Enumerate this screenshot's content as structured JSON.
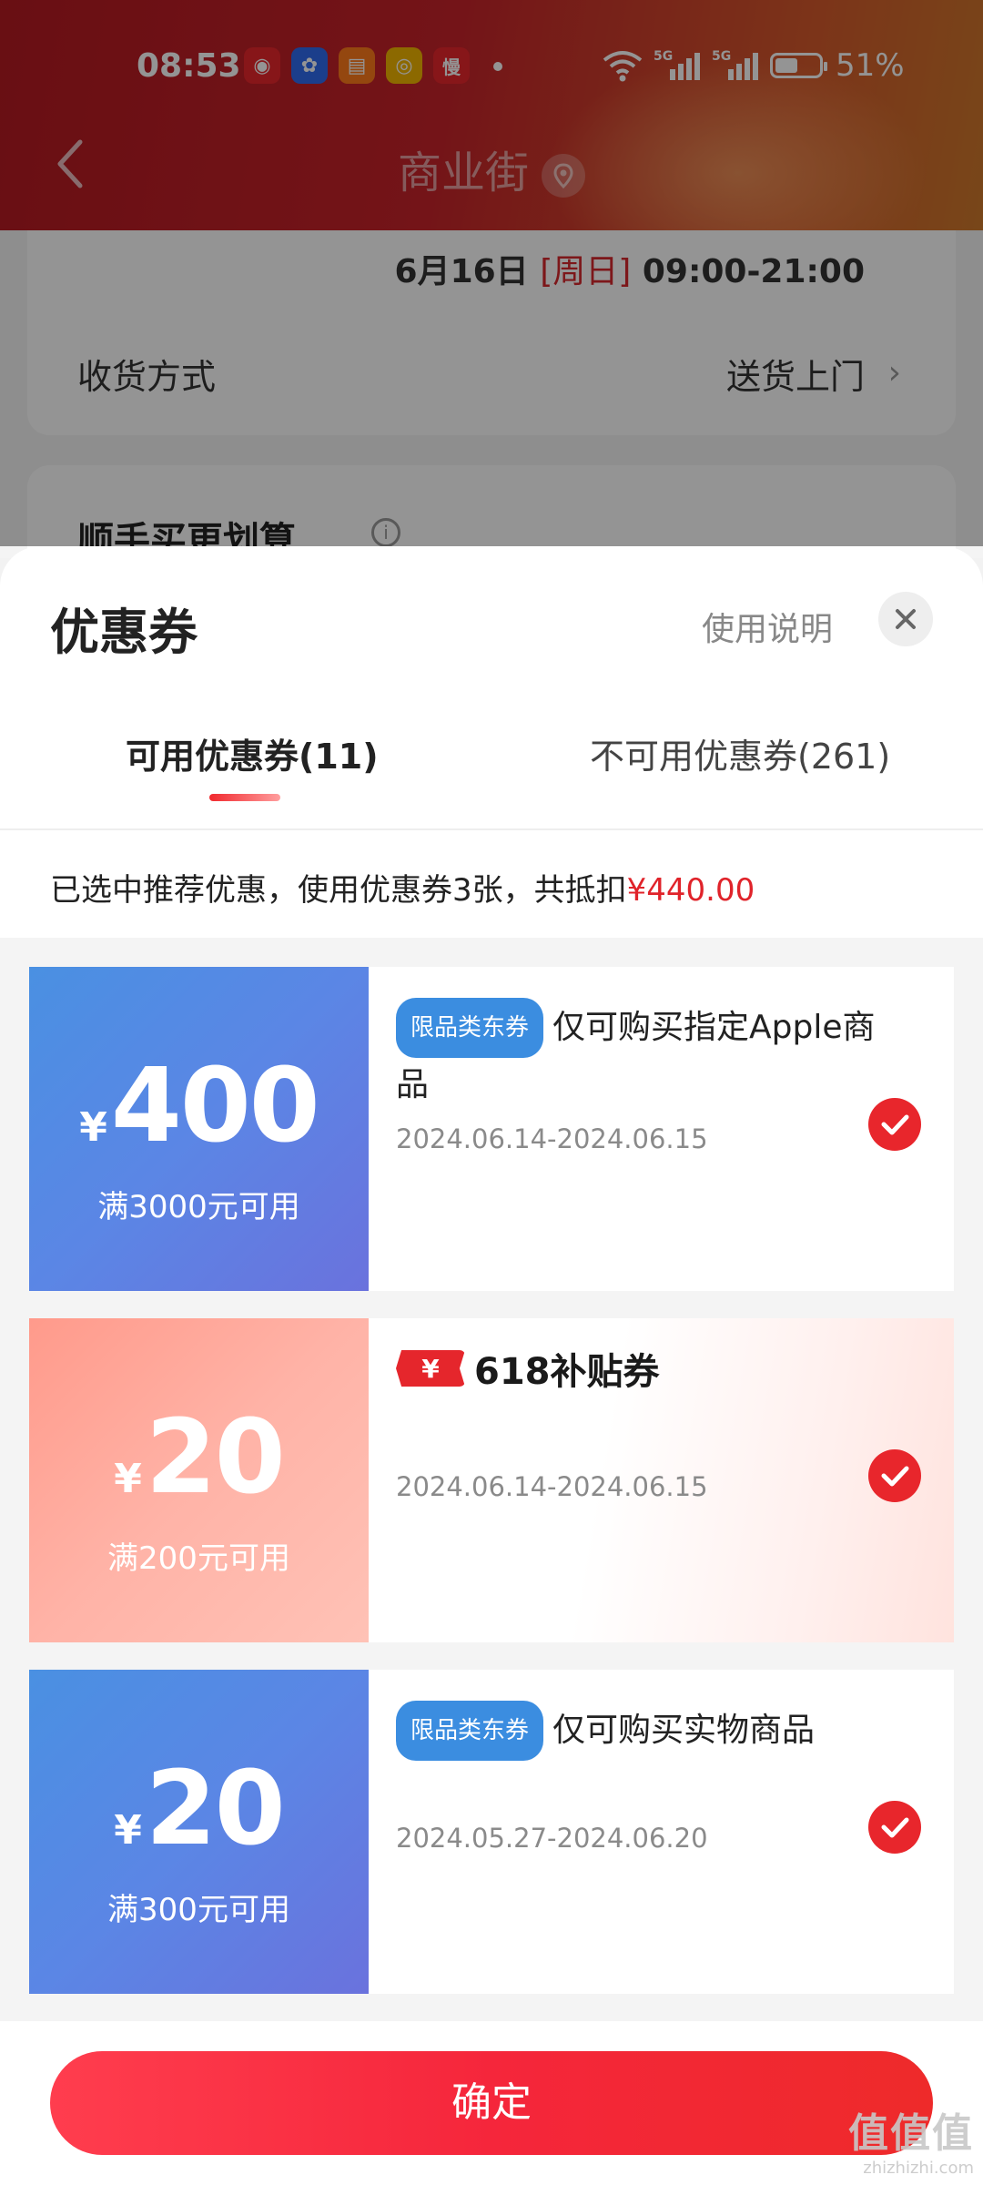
{
  "status_bar": {
    "time": "08:53",
    "battery": "51%",
    "network": "5G",
    "app_icons": [
      "微博",
      "百度",
      "书",
      "微博",
      "慢"
    ]
  },
  "header": {
    "title": "商业街"
  },
  "background_page": {
    "delivery_time_date": "6月16日",
    "delivery_time_weekday": "[周日]",
    "delivery_time_range": "09:00-21:00",
    "receive_method_label": "收货方式",
    "receive_method_value": "送货上门",
    "upsell_title": "顺手买更划算"
  },
  "sheet": {
    "title": "优惠券",
    "usage_label": "使用说明",
    "tabs": [
      {
        "label": "可用优惠券(11)",
        "active": true
      },
      {
        "label": "不可用优惠券(261)",
        "active": false
      }
    ],
    "summary_text": "已选中推荐优惠，使用优惠券3张，共抵扣",
    "summary_amount": "¥440.00"
  },
  "coupons": [
    {
      "currency": "¥",
      "amount": "400",
      "condition": "满3000元可用",
      "tag": "限品类东券",
      "description": "仅可购买指定Apple商品",
      "date_range": "2024.06.14-2024.06.15",
      "selected": true,
      "style": "blue"
    },
    {
      "currency": "¥",
      "amount": "20",
      "condition": "满200元可用",
      "badge_symbol": "¥",
      "badge_text": "618补贴券",
      "date_range": "2024.06.14-2024.06.15",
      "selected": true,
      "style": "pink"
    },
    {
      "currency": "¥",
      "amount": "20",
      "condition": "满300元可用",
      "tag": "限品类东券",
      "description": "仅可购买实物商品",
      "date_range": "2024.05.27-2024.06.20",
      "selected": true,
      "style": "blue"
    }
  ],
  "confirm_label": "确定",
  "watermark": {
    "big": "值值值",
    "small": "zhizhizhi.com"
  },
  "colors": {
    "accent_red": "#e8262c",
    "tag_blue": "#3b8de0",
    "coupon_blue": "#5b86e5",
    "coupon_pink": "#ffb3a7"
  }
}
